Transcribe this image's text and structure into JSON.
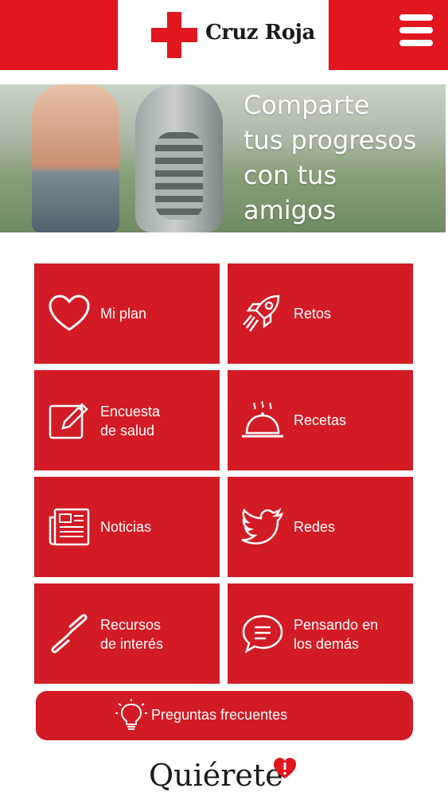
{
  "header": {
    "logo_text": "Cruz Roja",
    "brand_color": "#e1161f",
    "menu_icon": "hamburger-menu-icon"
  },
  "banner": {
    "lines": [
      "Comparte",
      "tus progresos",
      "con tus",
      "amigos"
    ]
  },
  "tiles": [
    {
      "label": "Mi plan",
      "icon": "heart-icon"
    },
    {
      "label": "Retos",
      "icon": "rocket-icon"
    },
    {
      "label_line1": "Encuesta",
      "label_line2": "de salud",
      "icon": "edit-icon"
    },
    {
      "label": "Recetas",
      "icon": "food-tray-icon"
    },
    {
      "label": "Noticias",
      "icon": "newspaper-icon"
    },
    {
      "label": "Redes",
      "icon": "twitter-bird-icon"
    },
    {
      "label_line1": "Recursos",
      "label_line2": "de interés",
      "icon": "link-icon"
    },
    {
      "label_line1": "Pensando en",
      "label_line2": "los demás",
      "icon": "speech-bubble-icon"
    }
  ],
  "faq": {
    "label": "Preguntas frecuentes",
    "icon": "lightbulb-icon"
  },
  "footer": {
    "logo_text": "Quiérete",
    "badge_icon": "heart-exclamation-icon"
  },
  "tile_color": "#d31b25"
}
